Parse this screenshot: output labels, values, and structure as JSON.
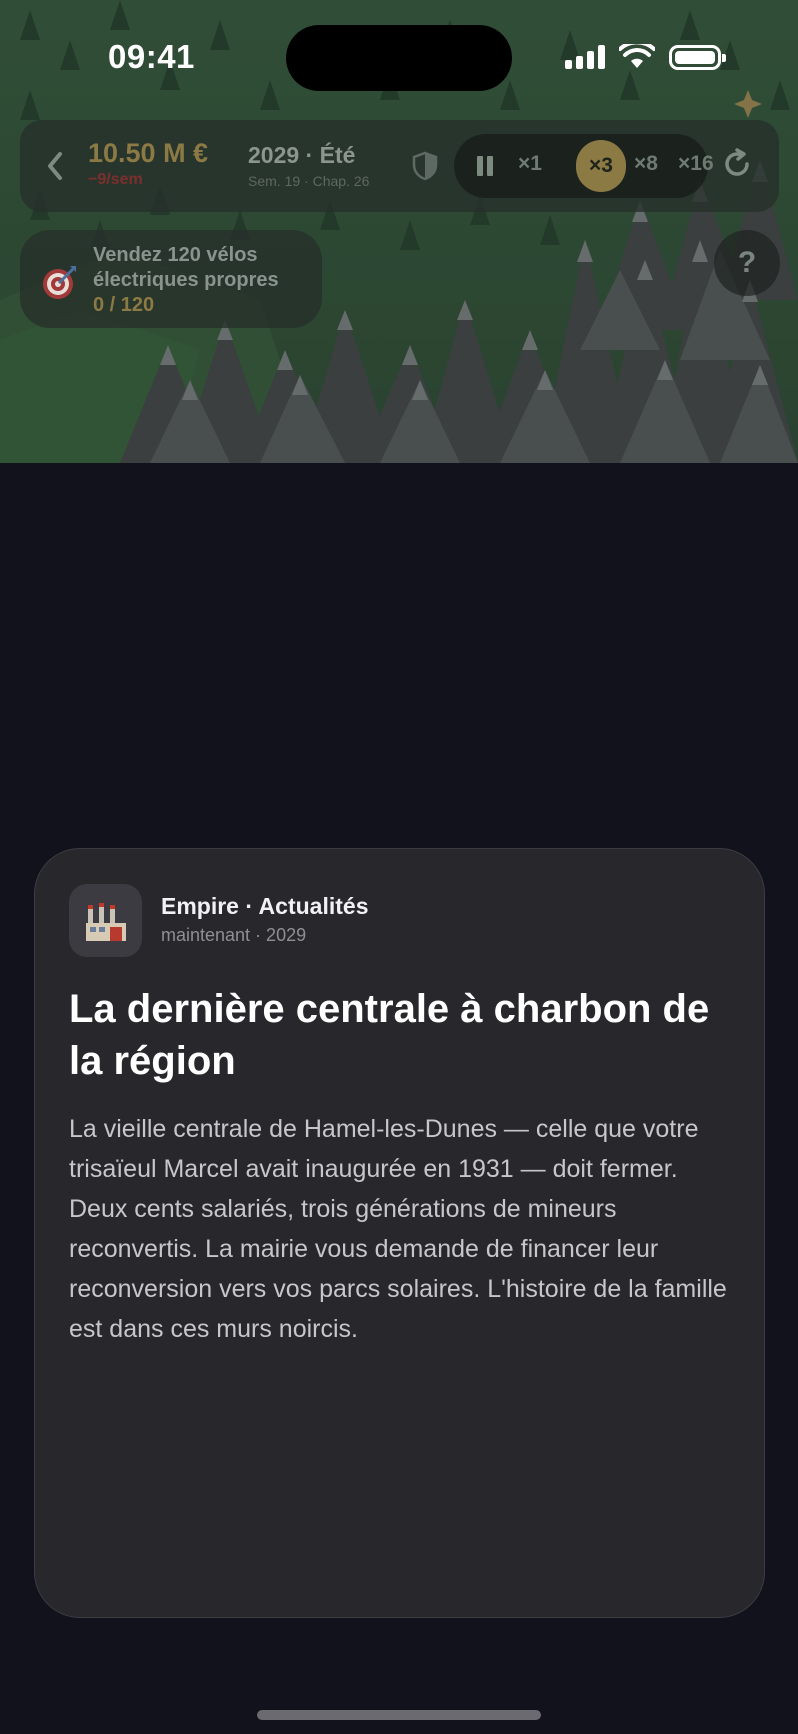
{
  "status_bar": {
    "time": "09:41"
  },
  "hud": {
    "money": "10.50 M €",
    "money_rate": "−9/sem",
    "date": "2029 · Été",
    "date_sub": "Sem. 19 · Chap. 26",
    "speed_options": [
      "×1",
      "×3",
      "×8",
      "×16"
    ],
    "active_speed": "×3",
    "icons": [
      "back-chevron-icon",
      "shield-icon",
      "pause-icon",
      "reset-icon"
    ]
  },
  "objective": {
    "line1": "Vendez 120 vélos",
    "line2": "électriques propres",
    "progress": "0 / 120",
    "icon": "target-icon"
  },
  "help": {
    "label": "?"
  },
  "news": {
    "source": "Empire · Actualités",
    "meta": "maintenant · 2029",
    "headline": "La dernière centrale à charbon de la région",
    "body": "La vieille centrale de Hamel-les-Dunes — celle que votre trisaïeul Marcel avait inaugurée en 1931 — doit fermer. Deux cents salariés, trois générations de mineurs reconvertis. La mairie vous demande de financer leur reconversion vers vos parcs solaires. L'histoire de la famille est dans ces murs noircis.",
    "icon": "factory-icon"
  },
  "colors": {
    "accent_gold": "#8c7a45",
    "warning_red": "#7c2f2c",
    "card_bg": "#27272c",
    "screen_bg": "#12121d"
  }
}
